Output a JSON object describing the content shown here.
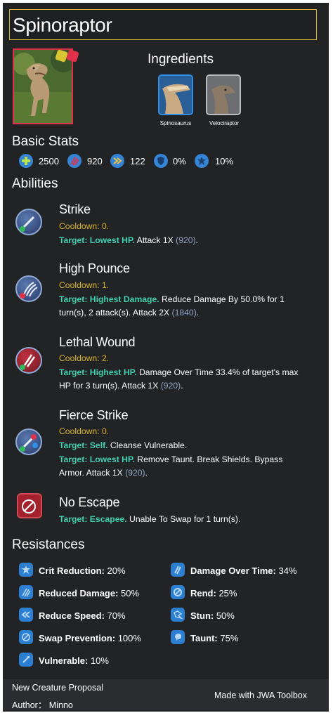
{
  "creature": {
    "name": "Spinoraptor",
    "colors": {
      "rarity_border": "#e0304a",
      "title_border": "#d8b83a",
      "target": "#3fd0b0",
      "cooldown": "#d9b62e"
    }
  },
  "ingredients": {
    "heading": "Ingredients",
    "items": [
      {
        "name": "Spinosaurus"
      },
      {
        "name": "Velociraptor"
      }
    ]
  },
  "stats": {
    "heading": "Basic Stats",
    "health": "2500",
    "damage": "920",
    "speed": "122",
    "armor": "0%",
    "crit": "10%"
  },
  "abilities": {
    "heading": "Abilities",
    "items": [
      {
        "name": "Strike",
        "lines": [
          {
            "cooldown": "Cooldown: 0."
          },
          {
            "target": "Target: Lowest HP.",
            "text": " Attack 1X ",
            "value": "(920)",
            "end": "."
          }
        ]
      },
      {
        "name": "High Pounce",
        "lines": [
          {
            "cooldown": "Cooldown: 1."
          },
          {
            "target": "Target: Highest Damage.",
            "text": " Reduce Damage By 50.0% for 1"
          },
          {
            "text": "turn(s), 2 attack(s). Attack 2X ",
            "value": "(1840)",
            "end": "."
          }
        ]
      },
      {
        "name": "Lethal Wound",
        "lines": [
          {
            "cooldown": "Cooldown: 2."
          },
          {
            "target": "Target: Highest HP.",
            "text": " Damage Over Time 33.4% of target's max"
          },
          {
            "text": "HP for 3 turn(s). Attack 1X ",
            "value": "(920)",
            "end": "."
          }
        ]
      },
      {
        "name": "Fierce Strike",
        "lines": [
          {
            "cooldown": "Cooldown: 0."
          },
          {
            "target": "Target: Self.",
            "text": " Cleanse Vulnerable."
          },
          {
            "target": "Target: Lowest HP.",
            "text": " Remove Taunt. Break Shields. Bypass"
          },
          {
            "text": "Armor. Attack 1X ",
            "value": "(920)",
            "end": "."
          }
        ]
      },
      {
        "name": "No Escape",
        "lines": [
          {
            "target": "Target: Escapee.",
            "text": " Unable To Swap for 1 turn(s)."
          }
        ]
      }
    ]
  },
  "resistances": {
    "heading": "Resistances",
    "items": [
      {
        "label": "Crit Reduction:",
        "value": " 20%",
        "icon": "crit-reduction-icon"
      },
      {
        "label": "Damage Over Time:",
        "value": " 34%",
        "icon": "damage-over-time-icon"
      },
      {
        "label": "Reduced Damage:",
        "value": " 50%",
        "icon": "reduced-damage-icon"
      },
      {
        "label": "Rend:",
        "value": " 25%",
        "icon": "rend-icon"
      },
      {
        "label": "Reduce Speed:",
        "value": " 70%",
        "icon": "reduce-speed-icon"
      },
      {
        "label": "Stun:",
        "value": " 50%",
        "icon": "stun-icon"
      },
      {
        "label": "Swap Prevention:",
        "value": " 100%",
        "icon": "swap-prevention-icon"
      },
      {
        "label": "Taunt:",
        "value": " 75%",
        "icon": "taunt-icon"
      },
      {
        "label": "Vulnerable:",
        "value": " 10%",
        "icon": "vulnerable-icon"
      }
    ]
  },
  "footer": {
    "proposal": "New Creature Proposal",
    "author": "Author：  Minno",
    "credit": "Made with JWA Toolbox"
  }
}
